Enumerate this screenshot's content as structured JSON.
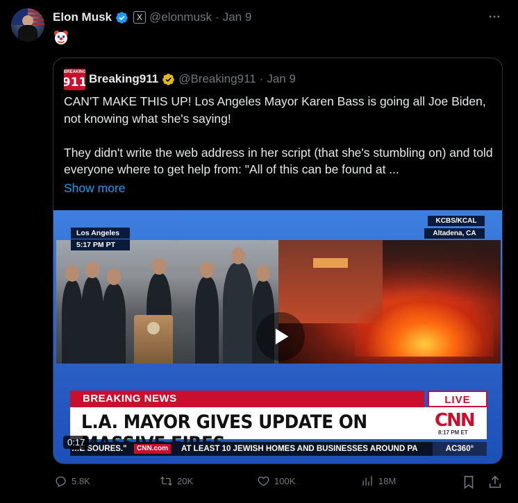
{
  "author": {
    "name": "Elon Musk",
    "handle": "@elonmusk",
    "separator": "·",
    "date": "Jan 9",
    "affiliate_badge": "X"
  },
  "tweet_text": "🤡",
  "quoted": {
    "name": "Breaking911",
    "avatar_small": "BREAKING",
    "avatar_big": "911",
    "handle": "@Breaking911",
    "separator": "·",
    "date": "Jan 9",
    "paragraph1": "CAN'T MAKE THIS UP! Los Angeles Mayor Karen Bass is going all Joe Biden, not knowing what she's saying!",
    "paragraph2": "They didn't write the web address in her script (that she's stumbling on) and told everyone where to get help from: \"All of this can be found at ...",
    "show_more": "Show more"
  },
  "video": {
    "location": "Los Angeles",
    "time": "5:17 PM PT",
    "station": "KCBS/KCAL",
    "place": "Altadena, CA",
    "breaking_label": "BREAKING NEWS",
    "live_label": "LIVE",
    "headline": "L.A. MAYOR GIVES UPDATE ON MASSIVE FIRES",
    "network_logo": "CNN",
    "network_time": "8:17 PM ET",
    "ticker_fragment": "…E SOURES.\"",
    "ticker_site": "CNN.com",
    "ticker_text": "AT LEAST 10 JEWISH HOMES AND BUSINESSES AROUND PA",
    "ticker_show": "AC360°",
    "duration": "0:17"
  },
  "actions": {
    "replies": "5.8K",
    "reposts": "20K",
    "likes": "100K",
    "views": "18M"
  },
  "colors": {
    "accent": "#1d9bf0",
    "verified_blue": "#1d9bf0",
    "verified_gold": "#e2b719",
    "muted": "#71767b",
    "cnn_red": "#c8102e"
  }
}
